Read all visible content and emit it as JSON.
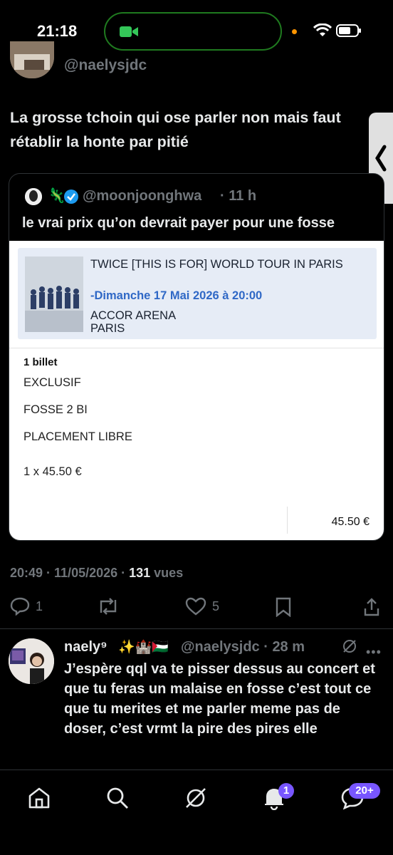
{
  "status_bar": {
    "time": "21:18"
  },
  "header": {
    "handle": "@naelysjdc"
  },
  "tweet": {
    "text": "La grosse tchoin qui ose parler non mais faut rétablir la honte par pitié",
    "timestamp": "20:49 · 11/05/2026 · ",
    "views_count": "131",
    "views_label": " vues",
    "replies": "1",
    "likes": "5"
  },
  "quote": {
    "emoji": "🦎",
    "handle": "@moonjoonghwa",
    "time": "· 11 h",
    "text": "le vrai prix qu’on devrait payer pour une fosse",
    "ticket": {
      "title": "TWICE [THIS IS FOR] WORLD TOUR IN PARIS",
      "date": "-Dimanche 17 Mai 2026  à 20:00",
      "venue": "ACCOR ARENA",
      "city": "PARIS",
      "count": "1 billet",
      "line1": "EXCLUSIF",
      "line2": "FOSSE 2 BI",
      "line3": "PLACEMENT LIBRE",
      "unit_price": "1 x 45.50 €",
      "total": "45.50 €"
    }
  },
  "reply": {
    "name": "naely⁹",
    "emoji": "✨🏰🇵🇸",
    "handle": "@naelysjdc · 28 m",
    "text": "J’espère qql va te pisser dessus au concert et que tu feras un malaise en fosse c’est tout ce que tu merites et me parler meme pas de doser, c’est vrmt la pire des pires elle"
  },
  "nav": {
    "notifications_badge": "1",
    "messages_badge": "20+"
  },
  "colors": {
    "accent": "#1d9bf0",
    "badge": "#7856ff",
    "muted": "#71767b"
  }
}
